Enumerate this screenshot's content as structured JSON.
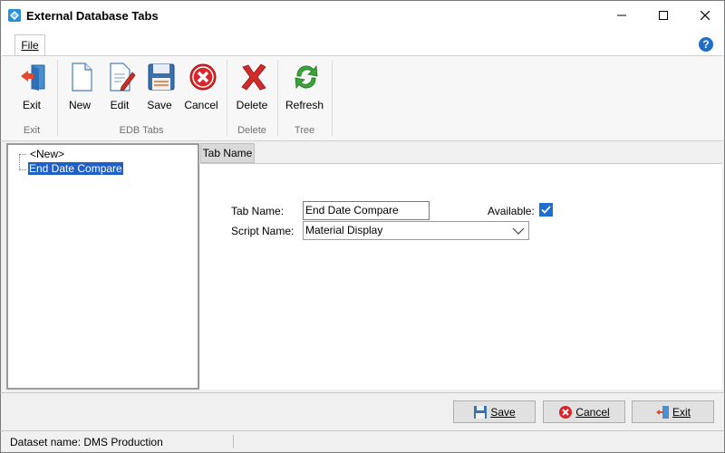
{
  "window": {
    "title": "External Database Tabs",
    "icon": "diamond-app-icon"
  },
  "ribbon_tabs": {
    "file_label": "File"
  },
  "ribbon": {
    "groups": [
      {
        "label": "Exit",
        "buttons": [
          {
            "label": "Exit",
            "icon": "exit-door-icon"
          }
        ]
      },
      {
        "label": "EDB Tabs",
        "buttons": [
          {
            "label": "New",
            "icon": "new-document-icon"
          },
          {
            "label": "Edit",
            "icon": "edit-document-icon"
          },
          {
            "label": "Save",
            "icon": "floppy-save-icon"
          },
          {
            "label": "Cancel",
            "icon": "red-cancel-icon"
          }
        ]
      },
      {
        "label": "Delete",
        "buttons": [
          {
            "label": "Delete",
            "icon": "red-x-delete-icon"
          }
        ]
      },
      {
        "label": "Tree",
        "buttons": [
          {
            "label": "Refresh",
            "icon": "green-refresh-icon"
          }
        ]
      }
    ]
  },
  "tree": {
    "items": [
      {
        "label": "<New>",
        "selected": false
      },
      {
        "label": "End Date Compare",
        "selected": true
      }
    ]
  },
  "detail": {
    "tab_label": "Tab Name",
    "tab_name_label": "Tab Name:",
    "tab_name_value": "End Date Compare",
    "available_label": "Available:",
    "available_checked": true,
    "script_name_label": "Script Name:",
    "script_name_value": "Material Display"
  },
  "bottom_buttons": {
    "save": "Save",
    "cancel": "Cancel",
    "exit": "Exit"
  },
  "status": {
    "text": "Dataset name:  DMS Production"
  },
  "colors": {
    "selection": "#1e60c8",
    "checkbox": "#1e6ed2",
    "help": "#1f6fc8"
  }
}
